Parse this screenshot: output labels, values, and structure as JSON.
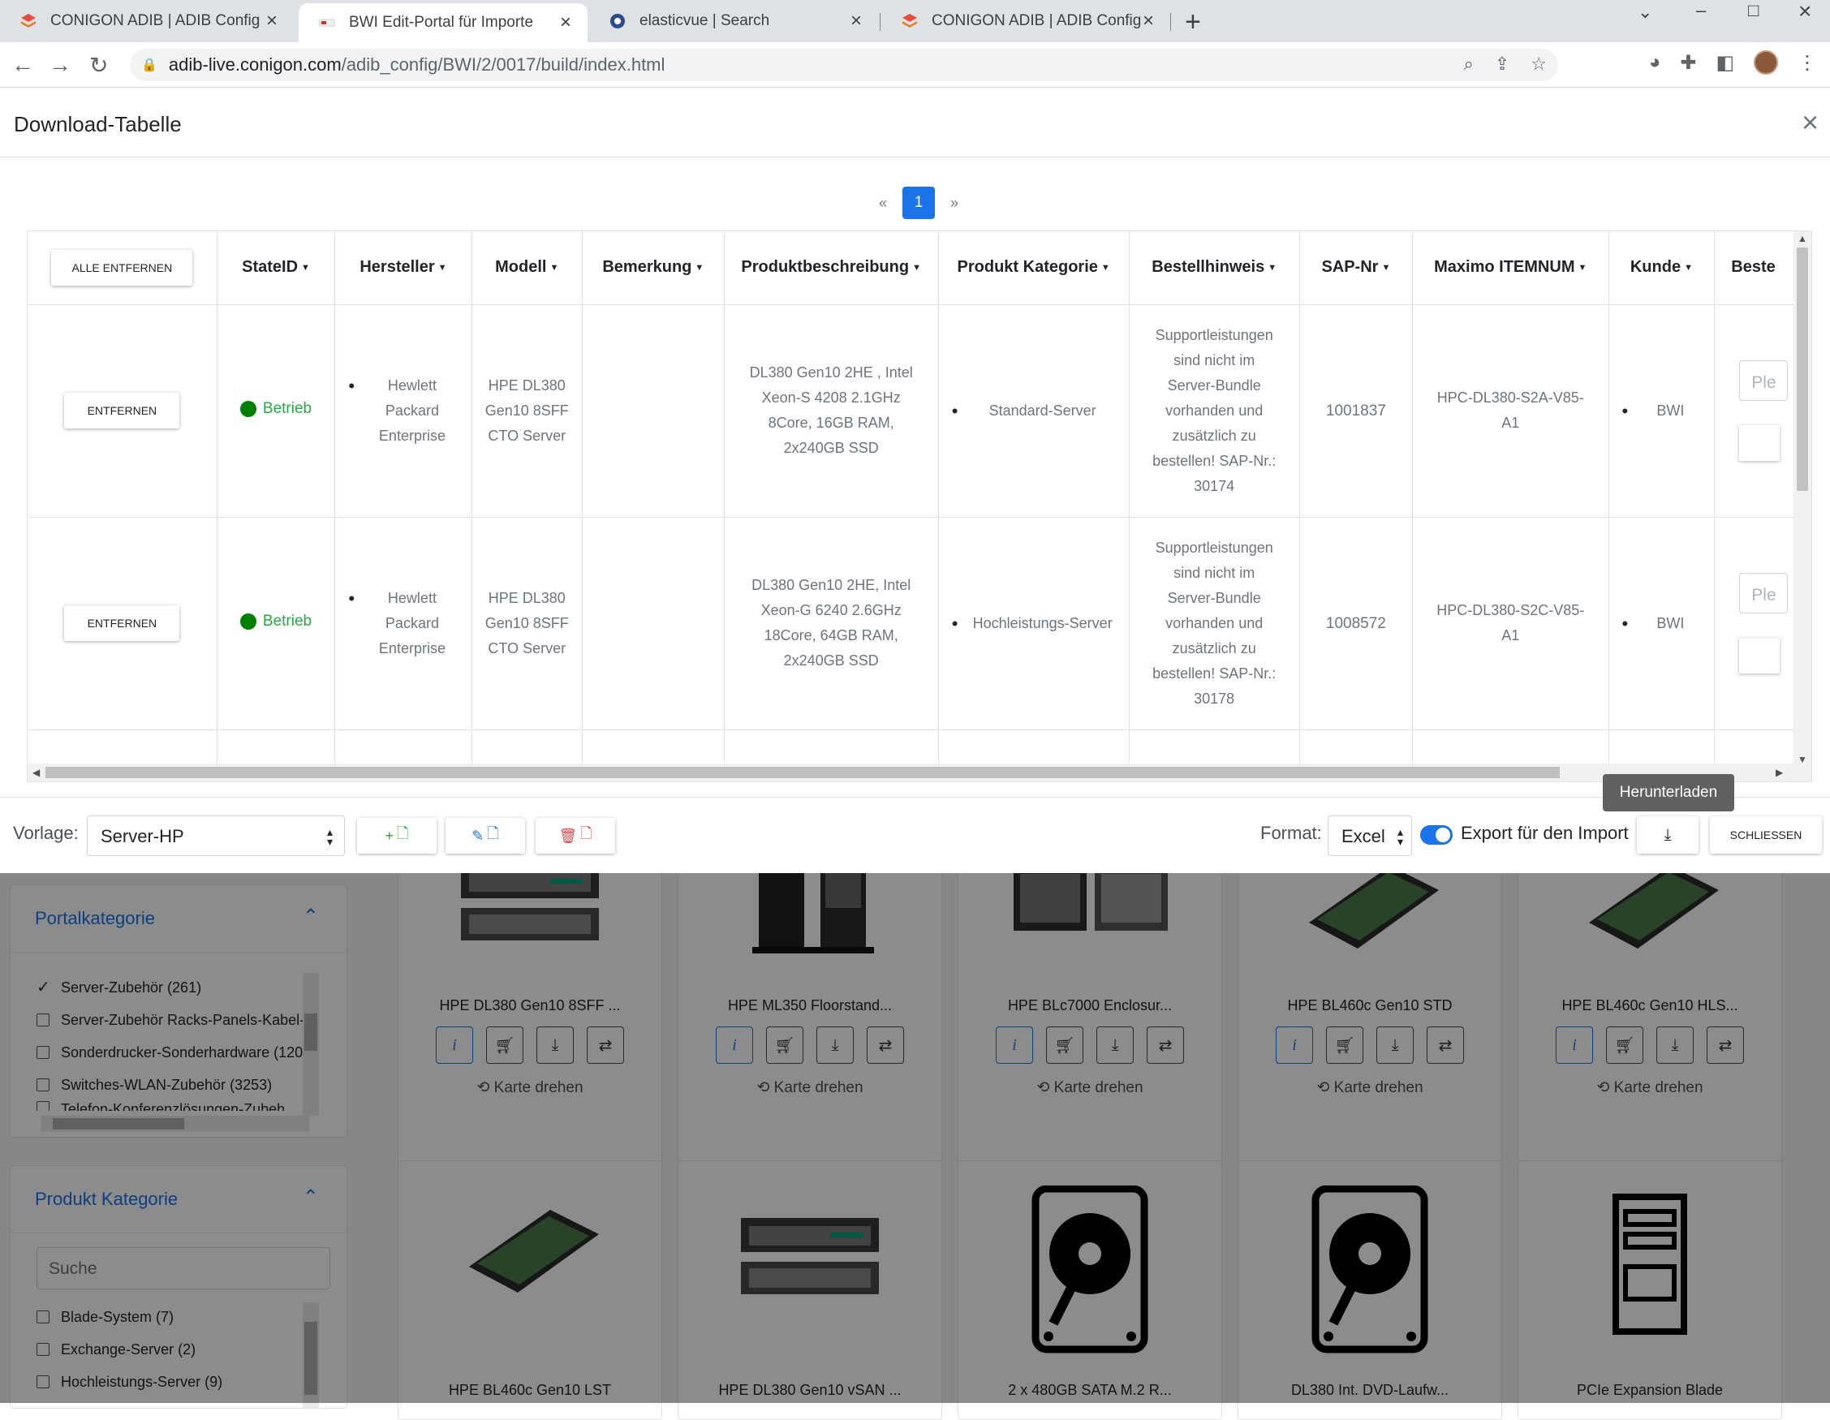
{
  "browser": {
    "tabs": [
      {
        "title": "CONIGON ADIB | ADIB Config",
        "active": false
      },
      {
        "title": "BWI Edit-Portal für Importe",
        "active": true
      },
      {
        "title": "elasticvue | Search",
        "active": false
      },
      {
        "title": "CONIGON ADIB | ADIB Config",
        "active": false
      }
    ],
    "url_host": "adib-live.conigon.com",
    "url_path": "/adib_config/BWI/2/0017/build/index.html"
  },
  "background": {
    "sidebar": {
      "portalkategorie": {
        "title": "Portalkategorie",
        "items": [
          {
            "label": "Server-Zubehör (261)",
            "checked": true
          },
          {
            "label": "Server-Zubehör Racks-Panels-Kabel-I",
            "checked": false
          },
          {
            "label": "Sonderdrucker-Sonderhardware (120",
            "checked": false
          },
          {
            "label": "Switches-WLAN-Zubehör (3253)",
            "checked": false
          },
          {
            "label": "Telefon-Konferenzlösungen-Zubeh",
            "checked": false
          }
        ]
      },
      "produktkategorie": {
        "title": "Produkt Kategorie",
        "search_placeholder": "Suche",
        "items": [
          {
            "label": "Blade-System (7)",
            "checked": false
          },
          {
            "label": "Exchange-Server (2)",
            "checked": false
          },
          {
            "label": "Hochleistungs-Server (9)",
            "checked": false
          }
        ]
      }
    },
    "cards_row1": [
      {
        "title": "HPE DL380 Gen10 8SFF ...",
        "flip": "Karte drehen"
      },
      {
        "title": "HPE ML350 Floorstand...",
        "flip": "Karte drehen"
      },
      {
        "title": "HPE BLc7000 Enclosur...",
        "flip": "Karte drehen"
      },
      {
        "title": "HPE BL460c Gen10 STD",
        "flip": "Karte drehen"
      },
      {
        "title": "HPE BL460c Gen10 HLS...",
        "flip": "Karte drehen"
      }
    ],
    "cards_row2": [
      {
        "title": "HPE BL460c Gen10 LST"
      },
      {
        "title": "HPE DL380 Gen10 vSAN ..."
      },
      {
        "title": "2 x 480GB SATA M.2 R..."
      },
      {
        "title": "DL380 Int. DVD-Laufw..."
      },
      {
        "title": "PCIe Expansion Blade"
      }
    ]
  },
  "modal": {
    "title": "Download-Tabelle",
    "pagination": {
      "prev": "«",
      "current": "1",
      "next": "»"
    },
    "table": {
      "remove_all_label": "ALLE ENTFERNEN",
      "columns": [
        "StateID",
        "Hersteller",
        "Modell",
        "Bemerkung",
        "Produktbeschreibung",
        "Produkt Kategorie",
        "Bestellhinweis",
        "SAP-Nr",
        "Maximo ITEMNUM",
        "Kunde",
        "Beste"
      ],
      "rows": [
        {
          "remove_label": "ENTFERNEN",
          "state": "Betrieb",
          "hersteller": "Hewlett Packard Enterprise",
          "modell": "HPE DL380 Gen10 8SFF CTO Server",
          "bemerkung": "",
          "produktbeschreibung": "DL380 Gen10 2HE , Intel Xeon-S 4208 2.1GHz 8Core, 16GB RAM, 2x240GB SSD",
          "kategorie": "Standard-Server",
          "bestellhinweis": "Supportleistungen sind nicht im Server-Bundle vorhanden und zusätzlich zu bestellen! SAP-Nr.: 30174",
          "sap": "1001837",
          "maximo": "HPC-DL380-S2A-V85-A1",
          "kunde": "BWI",
          "input_placeholder": "Ple"
        },
        {
          "remove_label": "ENTFERNEN",
          "state": "Betrieb",
          "hersteller": "Hewlett Packard Enterprise",
          "modell": "HPE DL380 Gen10 8SFF CTO Server",
          "bemerkung": "",
          "produktbeschreibung": "DL380 Gen10 2HE, Intel Xeon-G 6240 2.6GHz 18Core, 64GB RAM, 2x240GB SSD",
          "kategorie": "Hochleistungs-Server",
          "bestellhinweis": "Supportleistungen sind nicht im Server-Bundle vorhanden und zusätzlich zu bestellen! SAP-Nr.: 30178",
          "sap": "1008572",
          "maximo": "HPC-DL380-S2C-V85-A1",
          "kunde": "BWI",
          "input_placeholder": "Ple"
        }
      ]
    },
    "footer": {
      "vorlage_label": "Vorlage:",
      "vorlage_value": "Server-HP",
      "format_label": "Format:",
      "format_value": "Excel",
      "export_label": "Export für den Import",
      "export_enabled": true,
      "download_tooltip": "Herunterladen",
      "close_label": "SCHLIESSEN"
    }
  },
  "colors": {
    "accent": "#1a73e8",
    "status_green": "#008000"
  }
}
